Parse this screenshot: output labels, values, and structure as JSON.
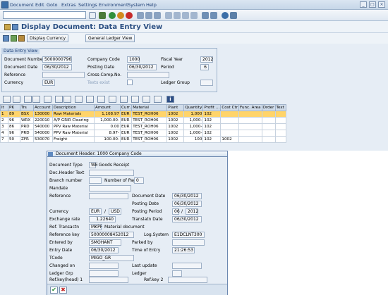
{
  "menu": {
    "items": [
      "Document",
      "Edit",
      "Goto",
      "Extras",
      "Settings",
      "Environment",
      "System",
      "Help"
    ]
  },
  "title": "Display Document: Data Entry View",
  "app_buttons": {
    "currency": "Display Currency",
    "gl_view": "General Ledger View"
  },
  "data_entry_view": {
    "group_title": "Data Entry View",
    "document_number_label": "Document Number",
    "document_number": "5000000796",
    "company_code_label": "Company Code",
    "company_code": "1000",
    "fiscal_year_label": "Fiscal Year",
    "fiscal_year": "2012",
    "document_date_label": "Document Date",
    "document_date": "06/30/2012",
    "posting_date_label": "Posting Date",
    "posting_date": "06/30/2012",
    "period_label": "Period",
    "period": "6",
    "reference_label": "Reference",
    "reference": "",
    "cross_comp_label": "Cross-Comp.No.",
    "cross_comp": "",
    "currency_label": "Currency",
    "currency": "EUR",
    "texts_exist_label": "Texts exist",
    "ledger_group_label": "Ledger Group",
    "ledger_group": ""
  },
  "grid": {
    "headers": [
      "It",
      "PK",
      "Trs",
      "Account",
      "Description",
      "Amount",
      "Curr.",
      "Material",
      "Plant",
      "Quantity",
      "Profit ...",
      "Cost Ctr",
      "Func. Area",
      "Order",
      "Text"
    ],
    "rows": [
      [
        "1",
        "89",
        "BSX",
        "130000",
        "Raw Materials",
        "1,108.97",
        "EUR",
        "TEST_ROH06",
        "1002",
        "1,000",
        "102",
        "",
        "",
        "",
        ""
      ],
      [
        "2",
        "96",
        "WRX",
        "220010",
        "A/P GRIR Clearing",
        "1,000.00-",
        "EUR",
        "TEST_ROH06",
        "1002",
        "1,000-",
        "102",
        "",
        "",
        "",
        ""
      ],
      [
        "3",
        "86",
        "PRD",
        "540000",
        "PPV Raw Material",
        "0.00",
        "EUR",
        "TEST_ROH06",
        "1002",
        "1,000-",
        "102",
        "",
        "",
        "",
        ""
      ],
      [
        "4",
        "96",
        "PRD",
        "540000",
        "PPV Raw Material",
        "8.97-",
        "EUR",
        "TEST_ROH06",
        "1002",
        "1,000-",
        "102",
        "",
        "",
        "",
        ""
      ],
      [
        "7",
        "50",
        "ZFR",
        "530070",
        "Freight",
        "100.00-",
        "EUR",
        "TEST_ROH06",
        "1002",
        "100",
        "102",
        "1002",
        "",
        "",
        ""
      ]
    ]
  },
  "dialog": {
    "title": "Document Header: 1000 Company Code",
    "doc_type_label": "Document Type",
    "doc_type": "WE",
    "doc_type_text": "Goods Receipt",
    "doc_header_text_label": "Doc.Header Text",
    "doc_header_text": "",
    "branch_label": "Branch number",
    "branch": "",
    "pages_label": "Number of Pages",
    "pages": "0",
    "mandate_label": "Mandate",
    "mandate": "",
    "reference_label": "Reference",
    "reference": "",
    "document_date_label": "Document Date",
    "document_date": "06/30/2012",
    "posting_date_label": "Posting Date",
    "posting_date": "06/30/2012",
    "currency_label": "Currency",
    "currency": "EUR",
    "currency2": "USD",
    "posting_period_label": "Posting Period",
    "posting_period": "06",
    "posting_year": "2012",
    "exchange_rate_label": "Exchange rate",
    "exchange_rate": "1.22640",
    "translatn_date_label": "Translatn Date",
    "translatn_date": "06/30/2012",
    "ref_transactn_label": "Ref. Transactn",
    "ref_transactn": "MKPF",
    "ref_transactn_text": "Material document",
    "reference_key_label": "Reference key",
    "reference_key": "50000008452012",
    "log_system_label": "Log.System",
    "log_system": "E1DCLNT300",
    "entered_by_label": "Entered by",
    "entered_by": "SMOHANT",
    "parked_by_label": "Parked by",
    "parked_by": "",
    "entry_date_label": "Entry Date",
    "entry_date": "06/30/2012",
    "time_of_entry_label": "Time of Entry",
    "time_of_entry": "21:26:53",
    "tcode_label": "TCode",
    "tcode": "MIGO_GR",
    "changed_on_label": "Changed on",
    "changed_on": "",
    "last_update_label": "Last update",
    "last_update": "",
    "ledger_grp_label": "Ledger Grp",
    "ledger_grp": "",
    "ledger_label": "Ledger",
    "ledger": "",
    "ref_key_head1_label": "Ref.key(head) 1",
    "ref_key_head1": "",
    "ref_key2_label": "Ref.key 2",
    "ref_key2": ""
  },
  "colors": {
    "accent": "#2b4f82",
    "selected_row": "#ffd46a",
    "frame": "#e6edf5"
  }
}
